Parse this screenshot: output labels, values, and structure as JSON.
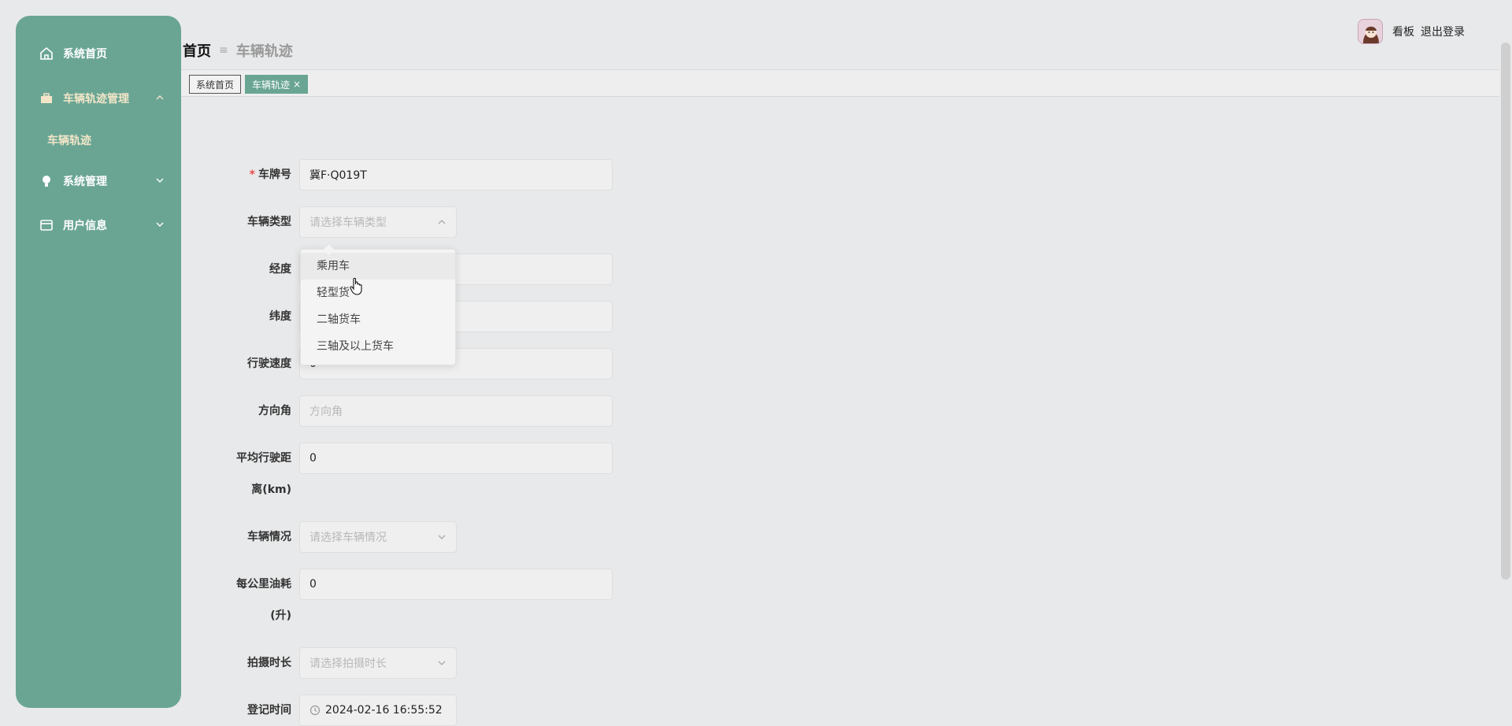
{
  "sidebar": {
    "items": [
      {
        "label": "系统首页",
        "icon": "home-icon"
      },
      {
        "label": "车辆轨迹管理",
        "icon": "briefcase-icon"
      },
      {
        "label": "系统管理",
        "icon": "bulb-icon"
      },
      {
        "label": "用户信息",
        "icon": "card-icon"
      }
    ],
    "subitem": "车辆轨迹"
  },
  "header": {
    "home": "首页",
    "separator": "≡",
    "current": "车辆轨迹"
  },
  "user": {
    "dashboard": "看板",
    "logout": "退出登录"
  },
  "tabs": [
    {
      "label": "系统首页"
    },
    {
      "label": "车辆轨迹",
      "close": "×"
    }
  ],
  "form": {
    "plate_label": "车牌号",
    "required_mark": "*",
    "plate_value": "冀F·Q019T",
    "type_label": "车辆类型",
    "type_placeholder": "请选择车辆类型",
    "lng_label": "经度",
    "lat_label": "纬度",
    "speed_label": "行驶速度",
    "speed_value": "0",
    "heading_label": "方向角",
    "heading_placeholder": "方向角",
    "avg_dist_label_1": "平均行驶距",
    "avg_dist_label_2": "离(km)",
    "avg_dist_value": "0",
    "condition_label": "车辆情况",
    "condition_placeholder": "请选择车辆情况",
    "fuel_label_1": "每公里油耗",
    "fuel_label_2": "(升)",
    "fuel_value": "0",
    "shoot_label": "拍摄时长",
    "shoot_placeholder": "请选择拍摄时长",
    "reg_label": "登记时间",
    "reg_value": "2024-02-16 16:55:52"
  },
  "dropdown": {
    "options": [
      "乘用车",
      "轻型货",
      "二轴货车",
      "三轴及以上货车"
    ]
  },
  "colors": {
    "sidebar": "#6aa594",
    "accent_text": "#f3e6c8",
    "required": "#e64d4d"
  }
}
